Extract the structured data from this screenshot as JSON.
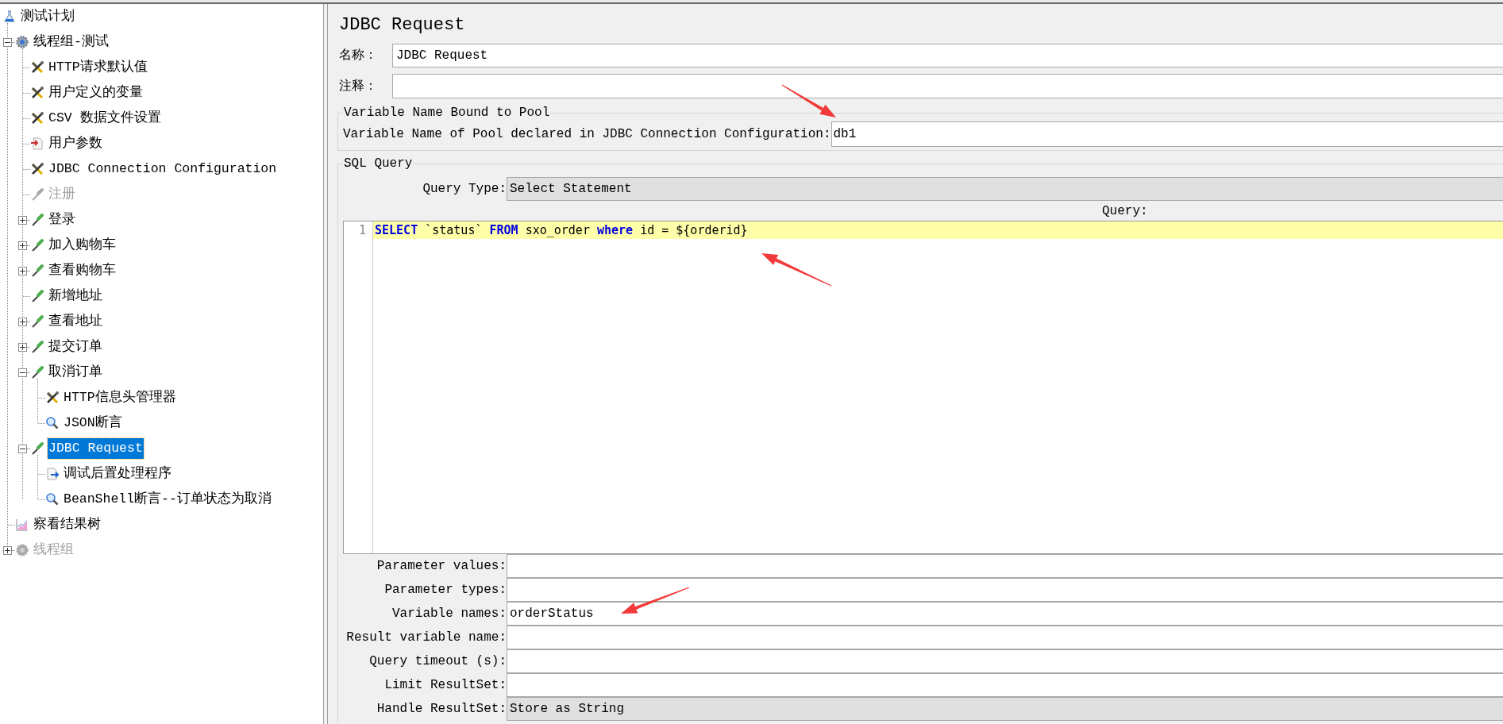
{
  "tree": [
    {
      "label": "测试计划",
      "kind": "plan",
      "selected": false,
      "disabled": false,
      "children": [
        {
          "label": "线程组-测试",
          "kind": "thread-group",
          "selected": false,
          "disabled": false,
          "expanded": true,
          "children": [
            {
              "label": "HTTP请求默认值",
              "kind": "config",
              "selected": false,
              "disabled": false
            },
            {
              "label": "用户定义的变量",
              "kind": "config",
              "selected": false,
              "disabled": false
            },
            {
              "label": "CSV 数据文件设置",
              "kind": "config",
              "selected": false,
              "disabled": false
            },
            {
              "label": "用户参数",
              "kind": "preprocessor",
              "selected": false,
              "disabled": false
            },
            {
              "label": "JDBC Connection Configuration",
              "kind": "config",
              "selected": false,
              "disabled": false
            },
            {
              "label": "注册",
              "kind": "sampler",
              "selected": false,
              "disabled": true
            },
            {
              "label": "登录",
              "kind": "sampler",
              "selected": false,
              "disabled": false,
              "expanded": false
            },
            {
              "label": "加入购物车",
              "kind": "sampler",
              "selected": false,
              "disabled": false,
              "expanded": false
            },
            {
              "label": "查看购物车",
              "kind": "sampler",
              "selected": false,
              "disabled": false,
              "expanded": false
            },
            {
              "label": "新增地址",
              "kind": "sampler",
              "selected": false,
              "disabled": false
            },
            {
              "label": "查看地址",
              "kind": "sampler",
              "selected": false,
              "disabled": false,
              "expanded": false
            },
            {
              "label": "提交订单",
              "kind": "sampler",
              "selected": false,
              "disabled": false,
              "expanded": false
            },
            {
              "label": "取消订单",
              "kind": "sampler",
              "selected": false,
              "disabled": false,
              "expanded": true,
              "children": [
                {
                  "label": "HTTP信息头管理器",
                  "kind": "config",
                  "selected": false,
                  "disabled": false
                },
                {
                  "label": "JSON断言",
                  "kind": "assertion",
                  "selected": false,
                  "disabled": false
                }
              ]
            },
            {
              "label": "JDBC Request",
              "kind": "sampler",
              "selected": true,
              "disabled": false,
              "expanded": true,
              "children": [
                {
                  "label": "调试后置处理程序",
                  "kind": "postprocessor",
                  "selected": false,
                  "disabled": false
                },
                {
                  "label": "BeanShell断言--订单状态为取消",
                  "kind": "assertion",
                  "selected": false,
                  "disabled": false
                }
              ]
            }
          ]
        },
        {
          "label": "察看结果树",
          "kind": "listener",
          "selected": false,
          "disabled": false
        },
        {
          "label": "线程组",
          "kind": "thread-group",
          "selected": false,
          "disabled": true,
          "expanded": false
        }
      ]
    }
  ],
  "editor_title": "JDBC Request",
  "name_field": {
    "label": "名称：",
    "value": "JDBC Request"
  },
  "comment_field": {
    "label": "注释："
  },
  "pool_section": {
    "legend": "Variable Name Bound to Pool",
    "label": "Variable Name of Pool declared in JDBC Connection Configuration:",
    "value": "db1",
    "arrow": true
  },
  "sql_section": {
    "legend": "SQL Query",
    "query_type": {
      "label": "Query Type:",
      "value": "Select Statement"
    },
    "query_label": "Query:",
    "arrow": true,
    "query_lines": [
      {
        "number": "1",
        "highlighted": true,
        "tokens": [
          {
            "kind": "keyword",
            "text": "SELECT"
          },
          {
            "kind": "plain",
            "text": " `status` "
          },
          {
            "kind": "keyword",
            "text": "FROM"
          },
          {
            "kind": "plain",
            "text": " sxo_order "
          },
          {
            "kind": "keyword",
            "text": "where"
          },
          {
            "kind": "plain",
            "text": " id = ${orderid}"
          }
        ]
      }
    ]
  },
  "parameters": [
    {
      "label": "Parameter values:",
      "kind": "text"
    },
    {
      "label": "Parameter types:",
      "kind": "text"
    },
    {
      "label": "Variable names:",
      "kind": "text",
      "value": "orderStatus",
      "arrow": true
    },
    {
      "label": "Result variable name:",
      "kind": "text"
    },
    {
      "label": "Query timeout (s):",
      "kind": "text"
    },
    {
      "label": "Limit ResultSet:",
      "kind": "text"
    },
    {
      "label": "Handle ResultSet:",
      "kind": "combo",
      "value": "Store as String"
    }
  ]
}
